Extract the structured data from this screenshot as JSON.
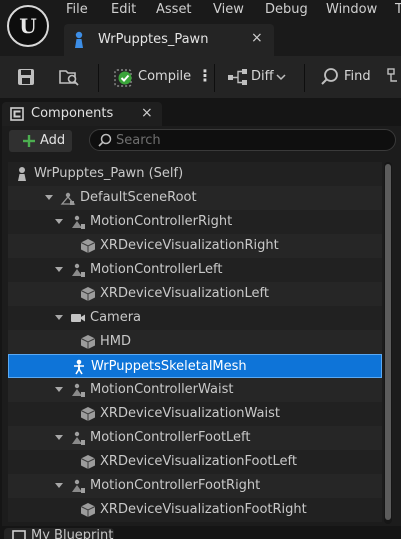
{
  "menu": [
    "File",
    "Edit",
    "Asset",
    "View",
    "Debug",
    "Window",
    "T"
  ],
  "document_tab": {
    "label": "WrPupptes_Pawn",
    "close": "×"
  },
  "toolbar": {
    "compile": "Compile",
    "diff": "Diff",
    "find": "Find"
  },
  "components_panel": {
    "tab_label": "Components",
    "close": "×",
    "add_label": "Add",
    "search_placeholder": "Search",
    "tree": [
      {
        "label": "WrPupptes_Pawn (Self)",
        "icon": "pawn-icon",
        "level": 0,
        "expandable": false
      },
      {
        "label": "DefaultSceneRoot",
        "icon": "scene-component-icon",
        "level": 1,
        "expandable": true
      },
      {
        "label": "MotionControllerRight",
        "icon": "motion-controller-icon",
        "level": 2,
        "expandable": true
      },
      {
        "label": "XRDeviceVisualizationRight",
        "icon": "static-mesh-icon",
        "level": 3,
        "expandable": false
      },
      {
        "label": "MotionControllerLeft",
        "icon": "motion-controller-icon",
        "level": 2,
        "expandable": true
      },
      {
        "label": "XRDeviceVisualizationLeft",
        "icon": "static-mesh-icon",
        "level": 3,
        "expandable": false
      },
      {
        "label": "Camera",
        "icon": "camera-icon",
        "level": 2,
        "expandable": true
      },
      {
        "label": "HMD",
        "icon": "static-mesh-icon",
        "level": 3,
        "expandable": false
      },
      {
        "label": "WrPuppetsSkeletalMesh",
        "icon": "skeletal-mesh-icon",
        "level": 2,
        "expandable": false,
        "selected": true
      },
      {
        "label": "MotionControllerWaist",
        "icon": "motion-controller-icon",
        "level": 2,
        "expandable": true
      },
      {
        "label": "XRDeviceVisualizationWaist",
        "icon": "static-mesh-icon",
        "level": 3,
        "expandable": false
      },
      {
        "label": "MotionControllerFootLeft",
        "icon": "motion-controller-icon",
        "level": 2,
        "expandable": true
      },
      {
        "label": "XRDeviceVisualizationFootLeft",
        "icon": "static-mesh-icon",
        "level": 3,
        "expandable": false
      },
      {
        "label": "MotionControllerFootRight",
        "icon": "motion-controller-icon",
        "level": 2,
        "expandable": true
      },
      {
        "label": "XRDeviceVisualizationFootRight",
        "icon": "static-mesh-icon",
        "level": 3,
        "expandable": false
      }
    ]
  },
  "bottom_tab": {
    "label": "My Blueprint"
  },
  "colors": {
    "selection": "#0e74d8",
    "accent_green": "#4caf50",
    "background": "#151515"
  }
}
